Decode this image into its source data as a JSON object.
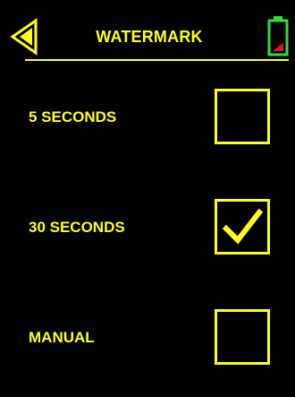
{
  "header": {
    "title": "WATERMARK",
    "back_icon": "back-arrow-icon",
    "battery_icon": "battery-icon",
    "battery_level": 0.3,
    "battery_outline_color": "#33dd33",
    "battery_fill_color": "#ee1111"
  },
  "options": [
    {
      "label": "5 SECONDS",
      "checked": false
    },
    {
      "label": "30 SECONDS",
      "checked": true
    },
    {
      "label": "MANUAL",
      "checked": false
    }
  ],
  "colors": {
    "accent": "#ffff1a",
    "background": "#000000"
  }
}
